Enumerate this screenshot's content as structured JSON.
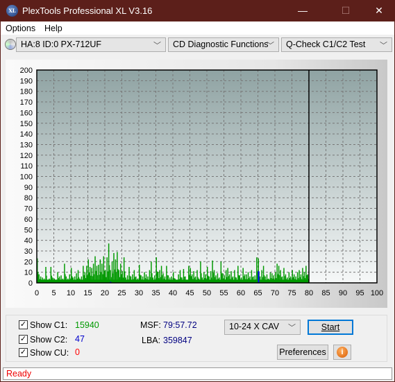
{
  "window": {
    "title": "PlexTools Professional XL V3.16",
    "logo_text": "XL",
    "minimize": "—",
    "maximize": "☐",
    "close": "✕"
  },
  "menu": {
    "options": "Options",
    "help": "Help"
  },
  "toolbar": {
    "drive": "HA:8 ID:0  PX-712UF",
    "function": "CD Diagnostic Functions",
    "test": "Q-Check C1/C2 Test",
    "chevron": "﹀"
  },
  "chart_data": {
    "type": "bar",
    "xlim": [
      0,
      100
    ],
    "ylim": [
      0,
      200
    ],
    "x_ticks": [
      0,
      5,
      10,
      15,
      20,
      25,
      30,
      35,
      40,
      45,
      50,
      55,
      60,
      65,
      70,
      75,
      80,
      85,
      90,
      95,
      100
    ],
    "y_ticks": [
      0,
      10,
      20,
      30,
      40,
      50,
      60,
      70,
      80,
      90,
      100,
      110,
      120,
      130,
      140,
      150,
      160,
      170,
      180,
      190,
      200
    ],
    "grid": true,
    "scan_end": 80,
    "x_step": 0.5,
    "series": [
      {
        "key": "C1",
        "color": "#009900",
        "values": [
          23,
          8,
          6,
          5,
          4,
          15,
          3,
          4,
          15,
          5,
          4,
          3,
          10,
          6,
          7,
          4,
          18,
          6,
          4,
          8,
          14,
          5,
          6,
          9,
          12,
          4,
          6,
          16,
          10,
          16,
          22,
          15,
          14,
          18,
          25,
          16,
          17,
          22,
          18,
          25,
          12,
          24,
          37,
          12,
          20,
          28,
          22,
          29,
          12,
          18,
          11,
          24,
          5,
          7,
          15,
          6,
          8,
          12,
          6,
          4,
          17,
          7,
          6,
          10,
          8,
          6,
          12,
          20,
          5,
          7,
          24,
          10,
          12,
          16,
          9,
          6,
          16,
          7,
          5,
          6,
          10,
          4,
          3,
          8,
          12,
          5,
          13,
          6,
          3,
          16,
          14,
          8,
          11,
          6,
          12,
          4,
          20,
          5,
          10,
          8,
          15,
          6,
          11,
          21,
          12,
          7,
          9,
          5,
          20,
          9,
          7,
          12,
          14,
          8,
          11,
          6,
          12,
          5,
          16,
          7,
          5,
          14,
          8,
          8,
          10,
          6,
          12,
          6,
          7,
          24,
          23,
          6,
          12,
          16,
          6,
          8,
          4,
          10,
          9,
          7,
          10,
          18,
          16,
          12,
          6,
          14,
          8,
          5,
          10,
          6,
          12,
          8,
          6,
          10,
          12,
          8,
          14,
          10,
          16,
          8
        ]
      },
      {
        "key": "C2",
        "color": "#0000ff",
        "points": [
          [
            21.5,
            1
          ],
          [
            65,
            11
          ]
        ]
      }
    ]
  },
  "stats": {
    "show_c1": "Show C1:",
    "c1": "15940",
    "show_c2": "Show C2:",
    "c2": "47",
    "show_cu": "Show CU:",
    "cu": "0",
    "msf_label": "MSF:",
    "msf": "79:57.72",
    "lba_label": "LBA:",
    "lba": "359847"
  },
  "colors": {
    "c1": "#009900",
    "c2": "#0000cc",
    "cu": "#ff0000"
  },
  "controls": {
    "speed": "10-24 X CAV",
    "start": "Start",
    "preferences": "Preferences",
    "info": "i"
  },
  "status": "Ready"
}
